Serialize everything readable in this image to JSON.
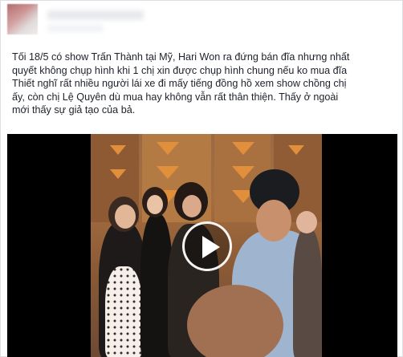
{
  "post": {
    "lines": [
      "Tối 18/5 có show Trấn Thành tại Mỹ, Hari Won ra đứng bán đĩa nhưng nhất",
      "quyết không chụp hình khi 1 chị xin được chụp hình chung nếu ko mua đĩa",
      "Thiết nghĩ rất nhiều người lái xe đi mấy tiếng đồng hồ xem show chồng chị",
      "ấy, còn chị Lệ Quyên dù mua hay không vẫn rất thân thiện. Thấy ở ngoài",
      "mới thấy sự giả tạo của bả."
    ]
  },
  "video": {
    "play_icon": "play-icon",
    "background": "#000000"
  },
  "colors": {
    "text": "#1d2129",
    "border": "#dddfe2",
    "triangle_accent": "#e28f3c"
  }
}
